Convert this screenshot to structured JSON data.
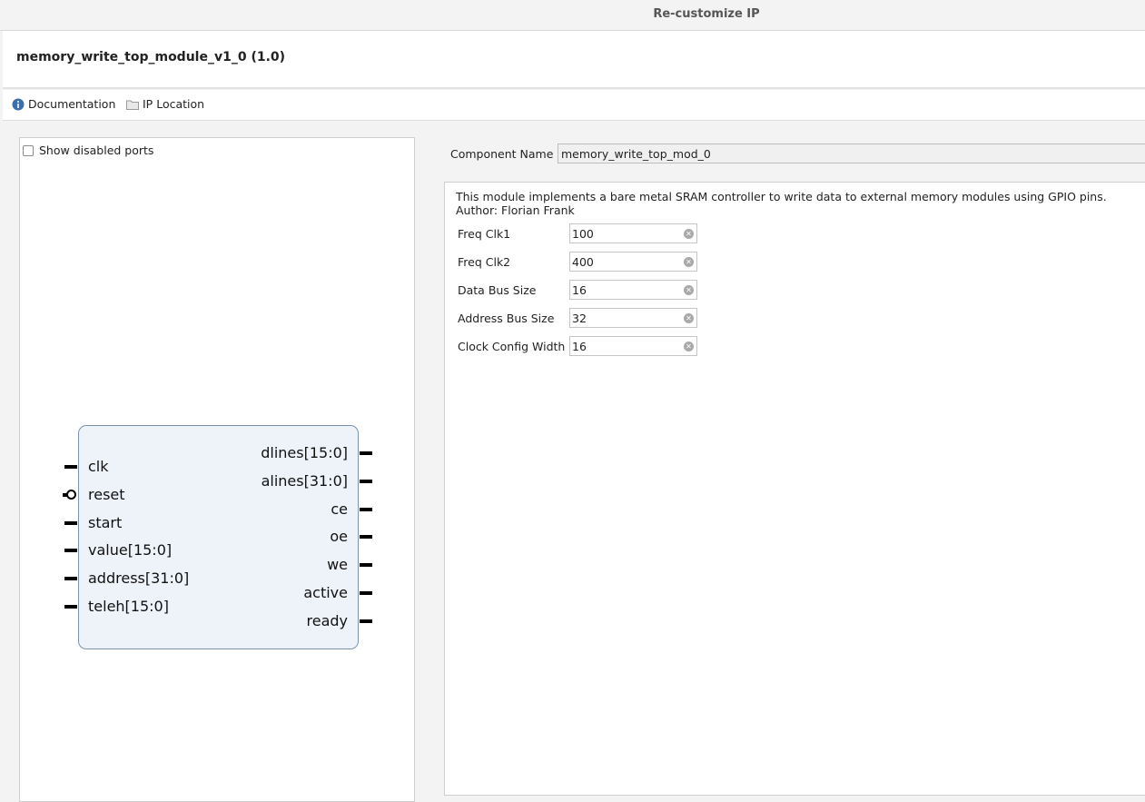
{
  "window": {
    "title": "Re-customize IP"
  },
  "header": {
    "module_name": "memory_write_top_module_v1_0 (1.0)"
  },
  "links": {
    "documentation": "Documentation",
    "ip_location": "IP Location"
  },
  "left_panel": {
    "show_disabled_ports": {
      "label": "Show disabled ports",
      "checked": false
    }
  },
  "symbol": {
    "inputs": [
      {
        "name": "clk",
        "inverted": false
      },
      {
        "name": "reset",
        "inverted": true
      },
      {
        "name": "start",
        "inverted": false
      },
      {
        "name": "value[15:0]",
        "inverted": false
      },
      {
        "name": "address[31:0]",
        "inverted": false
      },
      {
        "name": "teleh[15:0]",
        "inverted": false
      }
    ],
    "outputs": [
      "dlines[15:0]",
      "alines[31:0]",
      "ce",
      "oe",
      "we",
      "active",
      "ready"
    ]
  },
  "component": {
    "label": "Component Name",
    "value": "memory_write_top_mod_0"
  },
  "description": {
    "line1": "This module implements a bare metal SRAM controller to write data to external memory modules using GPIO pins.",
    "line2": "Author: Florian Frank"
  },
  "params": [
    {
      "label": "Freq Clk1",
      "value": "100"
    },
    {
      "label": "Freq Clk2",
      "value": "400"
    },
    {
      "label": "Data Bus Size",
      "value": "16"
    },
    {
      "label": "Address Bus Size",
      "value": "32"
    },
    {
      "label": "Clock Config Width",
      "value": "16"
    }
  ],
  "colors": {
    "symbol_fill": "#eef3f9",
    "symbol_border": "#7a93ad",
    "info_icon": "#3a6fb0"
  }
}
